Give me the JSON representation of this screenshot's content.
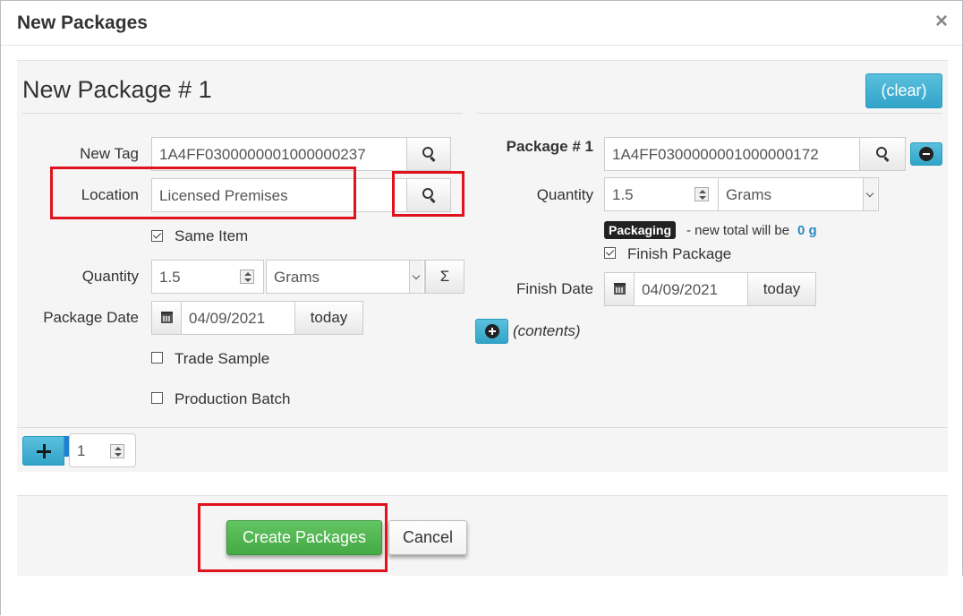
{
  "dialog": {
    "title": "New Packages",
    "close": "×"
  },
  "package": {
    "heading": "New Package # 1",
    "clear_label": "(clear)"
  },
  "left": {
    "new_tag_label": "New Tag",
    "new_tag_value": "1A4FF0300000001000000237",
    "location_label": "Location",
    "location_value": "Licensed Premises",
    "same_item_label": "Same Item",
    "quantity_label": "Quantity",
    "quantity_value": "1.5",
    "unit_value": "Grams",
    "sum_label": "Σ",
    "package_date_label": "Package Date",
    "package_date_value": "04/09/2021",
    "today_label": "today",
    "trade_sample_label": "Trade Sample",
    "production_batch_label": "Production Batch"
  },
  "right": {
    "package_label": "Package # 1",
    "package_tag_value": "1A4FF0300000001000000172",
    "quantity_label": "Quantity",
    "quantity_value": "1.5",
    "unit_value": "Grams",
    "packaging_badge": "Packaging",
    "new_total_text": "- new total will be",
    "new_total_value": "0 g",
    "finish_package_label": "Finish Package",
    "finish_date_label": "Finish Date",
    "finish_date_value": "04/09/2021",
    "today_label": "today",
    "contents_label": "(contents)"
  },
  "add_row": {
    "count_value": "1"
  },
  "footer": {
    "create_label": "Create Packages",
    "cancel_label": "Cancel"
  },
  "colors": {
    "highlight": "#e0121e",
    "info": "#31a4c8",
    "success": "#45a945",
    "total_value": "#2a8bc0"
  }
}
